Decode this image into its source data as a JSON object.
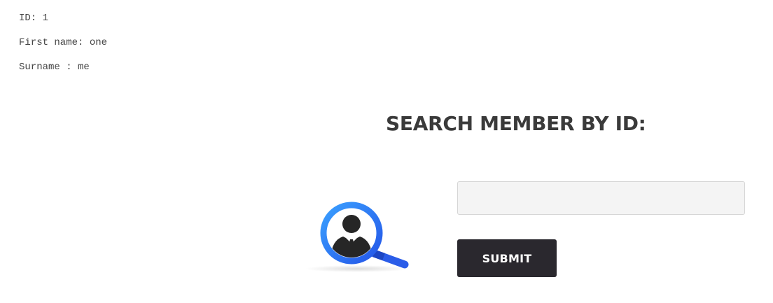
{
  "result": {
    "lines": [
      "ID: 1",
      "First name: one",
      "Surname : me"
    ]
  },
  "search": {
    "title": "SEARCH MEMBER BY ID:",
    "input_value": "",
    "input_placeholder": "",
    "submit_label": "SUBMIT"
  },
  "icons": {
    "illustration": "magnifier-user-icon"
  },
  "colors": {
    "title": "#3a3a3a",
    "button_background": "#2a282e",
    "button_text": "#ffffff",
    "input_background": "#f4f4f4",
    "input_border": "#d6d6d6",
    "icon_blue": "#2f6fef",
    "result_text": "#444444"
  }
}
